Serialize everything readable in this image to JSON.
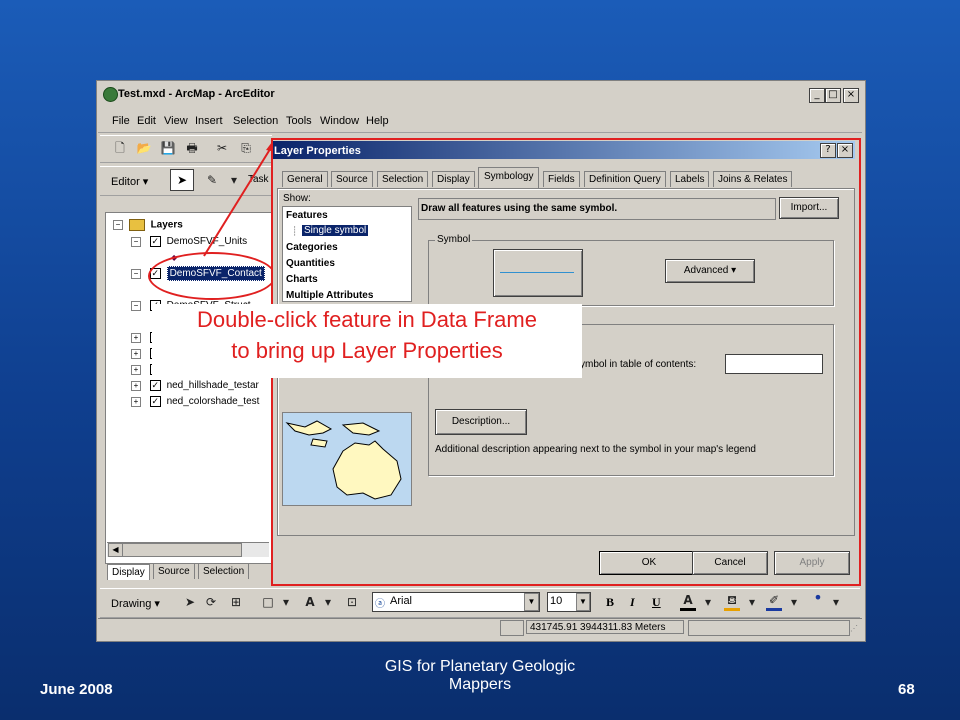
{
  "app": {
    "title": "Test.mxd - ArcMap - ArcEditor",
    "window_controls": [
      "_",
      "□",
      "×"
    ]
  },
  "menu": [
    "File",
    "Edit",
    "View",
    "Insert",
    "Selection",
    "Tools",
    "Window",
    "Help"
  ],
  "editor_toolbar": {
    "editor_label": "Editor ▾",
    "task_label": "Task"
  },
  "toc": {
    "root": "Layers",
    "layers": [
      {
        "name": "DemoSFVF_Units",
        "checked": true,
        "expanded": true
      },
      {
        "name": "DemoSFVF_Contact",
        "checked": true,
        "expanded": true,
        "selected": true
      },
      {
        "name": "DemoSFVF_Struct...",
        "checked": true,
        "expanded": true
      },
      {
        "name": "",
        "checked": true,
        "expanded": false
      },
      {
        "name": "",
        "checked": true,
        "expanded": false
      },
      {
        "name": "",
        "checked": true,
        "expanded": false
      },
      {
        "name": "ned_hillshade_testar",
        "checked": true,
        "expanded": false
      },
      {
        "name": "ned_colorshade_test",
        "checked": true,
        "expanded": false
      }
    ],
    "tabs": [
      "Display",
      "Source",
      "Selection"
    ]
  },
  "dialog": {
    "title": "Layer Properties",
    "tabs": [
      "General",
      "Source",
      "Selection",
      "Display",
      "Symbology",
      "Fields",
      "Definition Query",
      "Labels",
      "Joins & Relates"
    ],
    "active_tab": "Symbology",
    "show_label": "Show:",
    "show_items": [
      "Features",
      "Single symbol",
      "Categories",
      "Quantities",
      "Charts",
      "Multiple Attributes"
    ],
    "heading": "Draw all features using the same symbol.",
    "import_label": "Import...",
    "symbol_group": "Symbol",
    "advanced_label": "Advanced ▾",
    "legend_text": "ymbol in table of contents:",
    "description_label": "Description...",
    "description_text": "Additional description appearing next to the symbol in your map's legend",
    "ok": "OK",
    "cancel": "Cancel",
    "apply": "Apply"
  },
  "callout": {
    "line1": "Double-click feature in Data Frame",
    "line2": "to bring up Layer Properties"
  },
  "drawing_toolbar": {
    "drawing_label": "Drawing ▾",
    "font": "Arial",
    "size": "10",
    "bold": "B",
    "italic": "I",
    "underline": "U"
  },
  "status_bar": {
    "coords": "431745.91  3944311.83 Meters"
  },
  "footer": {
    "date": "June 2008",
    "title_line1": "GIS for Planetary Geologic",
    "title_line2": "Mappers",
    "page": "68"
  },
  "colors": {
    "accent": "#e02020",
    "slide_bg": "#1b5cb8",
    "titlebar": "#0a246a"
  }
}
